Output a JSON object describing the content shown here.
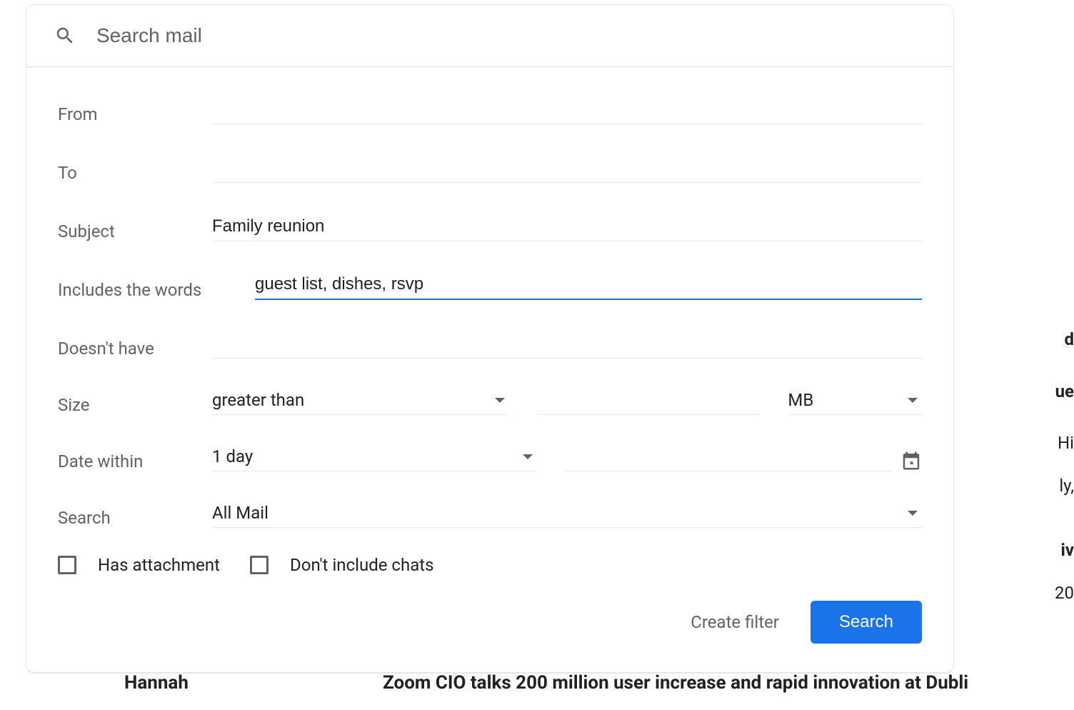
{
  "search": {
    "placeholder": "Search mail"
  },
  "form": {
    "from_label": "From",
    "from_value": "",
    "to_label": "To",
    "to_value": "",
    "subject_label": "Subject",
    "subject_value": "Family reunion",
    "includes_label": "Includes the words",
    "includes_value": "guest list, dishes, rsvp",
    "excludes_label": "Doesn't have",
    "excludes_value": "",
    "size_label": "Size",
    "size_compare": "greater than",
    "size_value": "",
    "size_unit": "MB",
    "date_label": "Date within",
    "date_range": "1 day",
    "date_value": "",
    "search_label": "Search",
    "search_location": "All Mail",
    "has_attachment_label": "Has attachment",
    "has_attachment_checked": false,
    "exclude_chats_label": "Don't include chats",
    "exclude_chats_checked": false
  },
  "actions": {
    "create_filter": "Create filter",
    "search_button": "Search"
  },
  "background": {
    "snippet1": "d",
    "snippet2": "ue",
    "snippet3": "Hi",
    "snippet4": "ly,",
    "snippet5": "iv",
    "snippet6": "20",
    "sender": "Hannah",
    "preview": "Zoom CIO talks 200 million user increase and rapid innovation at Dubli"
  }
}
